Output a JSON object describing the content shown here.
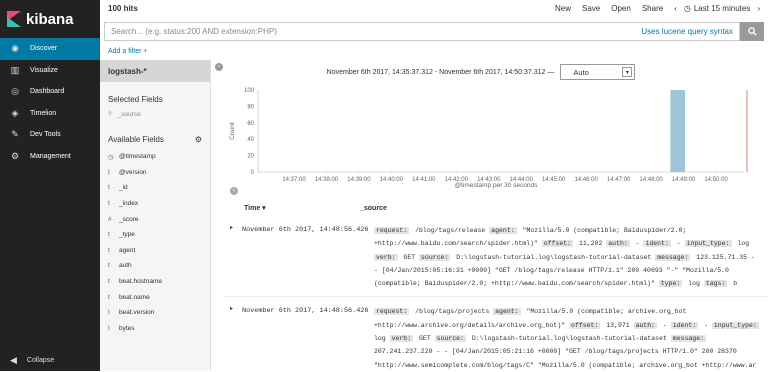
{
  "app": {
    "name": "kibana"
  },
  "nav": {
    "items": [
      {
        "label": "Discover",
        "icon": "compass-icon"
      },
      {
        "label": "Visualize",
        "icon": "bar-chart-icon"
      },
      {
        "label": "Dashboard",
        "icon": "dashboard-icon"
      },
      {
        "label": "Timelion",
        "icon": "shield-icon"
      },
      {
        "label": "Dev Tools",
        "icon": "wrench-icon"
      },
      {
        "label": "Management",
        "icon": "gear-icon"
      }
    ],
    "collapse": "Collapse"
  },
  "topbar": {
    "hits": "100 hits",
    "new": "New",
    "save": "Save",
    "open": "Open",
    "share": "Share",
    "time": "Last 15 minutes"
  },
  "search": {
    "placeholder": "Search... (e.g. status:200 AND extension:PHP)",
    "lucene": "Uses lucene query syntax"
  },
  "filter": {
    "add": "Add a filter +"
  },
  "sidebar": {
    "index": "logstash-*",
    "selected_title": "Selected Fields",
    "source": "_source",
    "source_type": "?",
    "available_title": "Available Fields",
    "fields": [
      {
        "type": "◷",
        "name": "@timestamp"
      },
      {
        "type": "t",
        "name": "@version"
      },
      {
        "type": "t",
        "name": "_id"
      },
      {
        "type": "t",
        "name": "_index"
      },
      {
        "type": "#",
        "name": "_score"
      },
      {
        "type": "t",
        "name": "_type"
      },
      {
        "type": "t",
        "name": "agent"
      },
      {
        "type": "t",
        "name": "auth"
      },
      {
        "type": "t",
        "name": "beat.hostname"
      },
      {
        "type": "t",
        "name": "beat.name"
      },
      {
        "type": "t",
        "name": "beat.version"
      },
      {
        "type": "t",
        "name": "bytes"
      }
    ]
  },
  "timerange": {
    "label": "November 6th 2017, 14:35:37.312 - November 6th 2017, 14:50:37.312 —",
    "interval": "Auto"
  },
  "chart_data": {
    "type": "bar",
    "categories": [
      "14:37:00",
      "14:38:00",
      "14:39:00",
      "14:40:00",
      "14:41:00",
      "14:42:00",
      "14:43:00",
      "14:44:00",
      "14:45:00",
      "14:46:00",
      "14:47:00",
      "14:48:00",
      "14:49:00",
      "14:50:00"
    ],
    "values": [
      0,
      0,
      0,
      0,
      0,
      0,
      0,
      0,
      0,
      0,
      0,
      0,
      100,
      0
    ],
    "xlabel": "@timestamp per 30 seconds",
    "ylabel": "Count",
    "yticks": [
      0,
      20,
      40,
      60,
      80,
      100
    ],
    "ylim": [
      0,
      100
    ],
    "bar_color": "#9fc5d8"
  },
  "table": {
    "col_time": "Time",
    "col_source": "_source",
    "rows": [
      {
        "time": "November 6th 2017, 14:48:56.426",
        "fields": [
          {
            "k": "request:",
            "v": " /blog/tags/release "
          },
          {
            "k": "agent:",
            "v": " \"Mozilla/5.0 (compatible; Baiduspider/2.0; +http://www.baidu.com/search/spider.html)\" "
          },
          {
            "k": "offset:",
            "v": " 11,202 "
          },
          {
            "k": "auth:",
            "v": " - "
          },
          {
            "k": "ident:",
            "v": " - "
          },
          {
            "k": "input_type:",
            "v": " log "
          },
          {
            "k": "verb:",
            "v": " GET "
          },
          {
            "k": "source:",
            "v": " D:\\logstash-tutorial.log\\logstash-tutorial-dataset "
          },
          {
            "k": "message:",
            "v": " 123.125.71.35 - - [04/Jan/2015:05:16:31 +0000] \"GET /blog/tags/release HTTP/1.1\" 200 40693 \"-\" \"Mozilla/5.0 (compatible; Baiduspider/2.0; +http://www.baidu.com/search/spider.html)\" "
          },
          {
            "k": "type:",
            "v": " log "
          },
          {
            "k": "tags:",
            "v": " b"
          }
        ]
      },
      {
        "time": "November 6th 2017, 14:48:56.426",
        "fields": [
          {
            "k": "request:",
            "v": " /blog/tags/projects "
          },
          {
            "k": "agent:",
            "v": " \"Mozilla/5.0 (compatible; archive.org_bot +http://www.archive.org/details/archive.org_bot)\" "
          },
          {
            "k": "offset:",
            "v": " 13,971 "
          },
          {
            "k": "auth:",
            "v": " - "
          },
          {
            "k": "ident:",
            "v": " - "
          },
          {
            "k": "input_type:",
            "v": " log "
          },
          {
            "k": "verb:",
            "v": " GET "
          },
          {
            "k": "source:",
            "v": " D:\\logstash-tutorial.log\\logstash-tutorial-dataset "
          },
          {
            "k": "message:",
            "v": " 207.241.237.220 - - [04/Jan/2015:05:21:16 +0000] \"GET /blog/tags/projects HTTP/1.0\" 200 28370 \"http://www.semicomplete.com/blog/tags/C\" \"Mozilla/5.0 (compatible; archive.org_bot +http://www.ar"
          }
        ]
      }
    ]
  },
  "colors": {
    "nav_bg": "#222222",
    "nav_active": "#0079a5",
    "accent": "#0079a5"
  }
}
